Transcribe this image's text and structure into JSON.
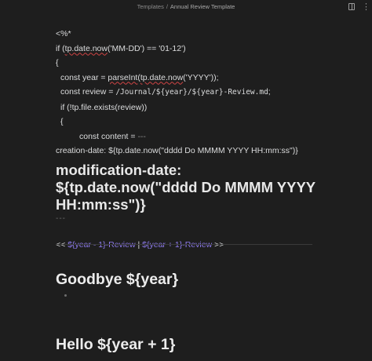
{
  "breadcrumb": {
    "folder": "Templates",
    "separator": "/",
    "file": "Annual Review Template"
  },
  "icons": {
    "reading_view": "book-open-icon",
    "more": "more-options-icon"
  },
  "code": {
    "l1": "<%*",
    "l2a": "if (",
    "l2b": "tp.date.now",
    "l2c": "('MM-DD') == '01-12')",
    "l3": "{",
    "l4a": "const year = ",
    "l4b": "parseInt",
    "l4c": "(",
    "l4d": "tp.date.now",
    "l4e": "('YYYY'));",
    "l5a": "const review = ",
    "l5b": "/Journal/${year}/${year}-Review.md",
    "l5c": ";",
    "l6": "if (!tp.file.exists(review))",
    "l7": "{",
    "l8a": "const content = ",
    "l8b": "---",
    "l9": "creation-date: ${tp.date.now(\"dddd Do MMMM YYYY HH:mm:ss\")}"
  },
  "modification_heading": "modification-date: ${tp.date.now(\"dddd Do MMMM YYYY HH:mm:ss\")}",
  "frontmatter_end": "---",
  "nav": {
    "open": "<<",
    "prev_link": "${year - 1}-Review",
    "divider": "|",
    "next_link": "${year + 1}-Review",
    "close": ">>"
  },
  "heading_goodbye": "Goodbye ${year}",
  "heading_hello": "Hello ${year + 1}"
}
